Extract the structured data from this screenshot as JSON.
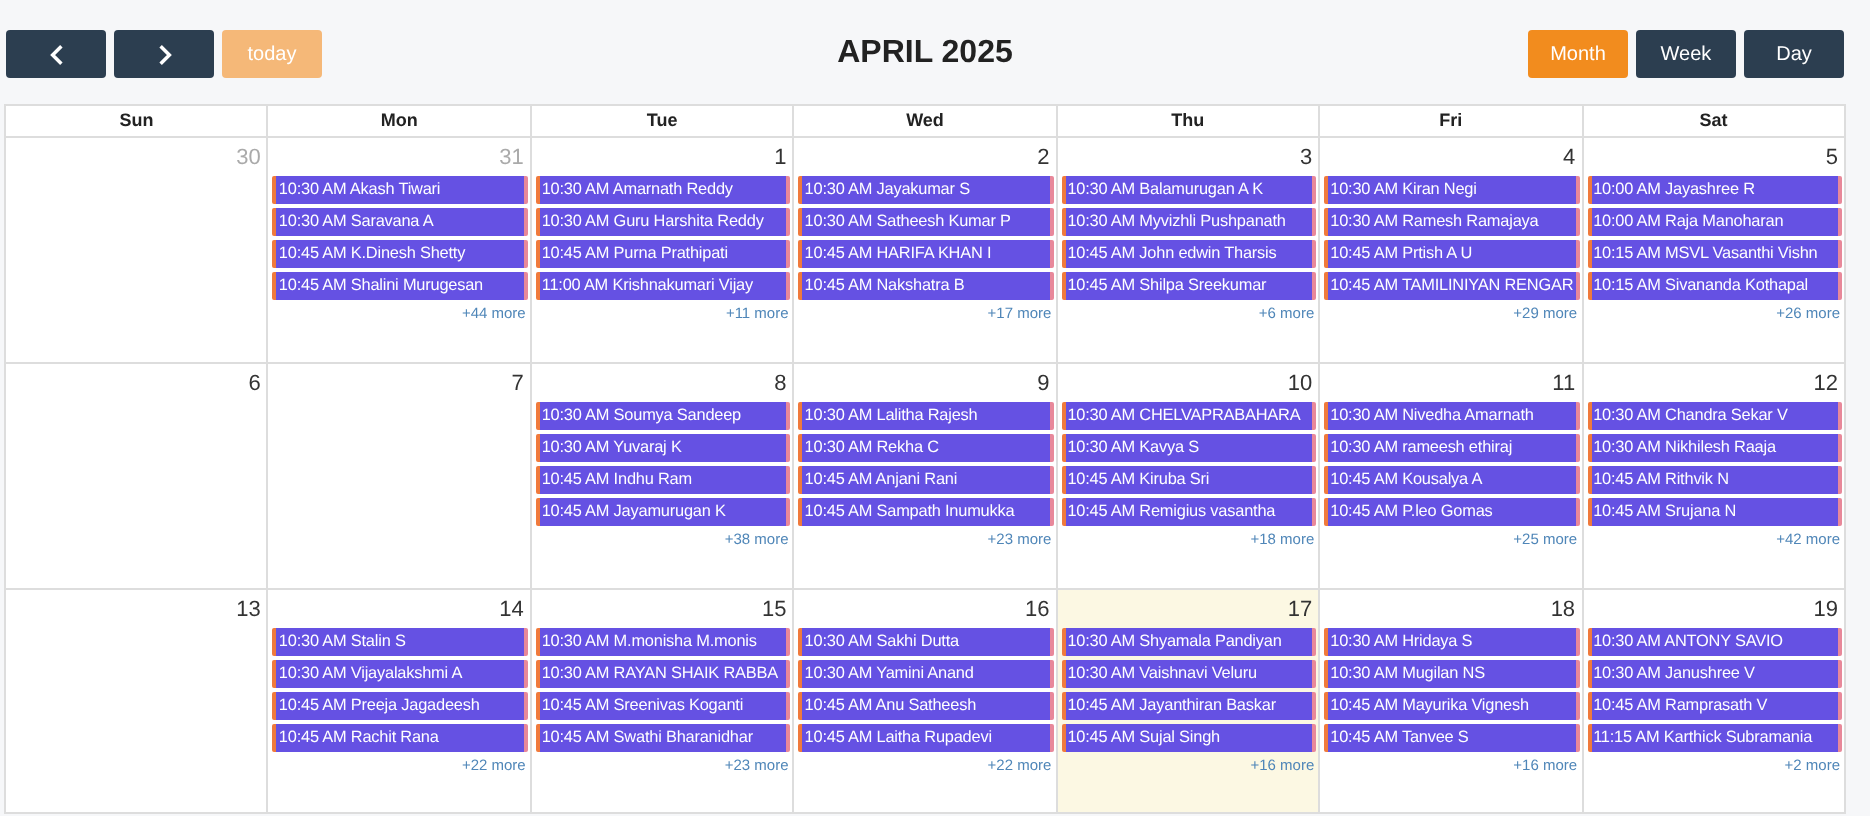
{
  "toolbar": {
    "nav_buttons": [
      {
        "kind": "prev"
      },
      {
        "kind": "next"
      }
    ],
    "today_button": {
      "label": "today",
      "disabled": true
    },
    "title": "APRIL 2025",
    "views": [
      {
        "label": "Month",
        "selected": true
      },
      {
        "label": "Week",
        "selected": false
      },
      {
        "label": "Day",
        "selected": false
      }
    ]
  },
  "calendar": {
    "weekdays": [
      "Sun",
      "Mon",
      "Tue",
      "Wed",
      "Thu",
      "Fri",
      "Sat"
    ],
    "weeks": [
      [
        {
          "day": "30",
          "other_month": true,
          "today": false
        },
        {
          "day": "31",
          "other_month": true,
          "today": false,
          "events": [
            "10:30 AM Akash Tiwari",
            "10:30 AM Saravana A",
            "10:45 AM K.Dinesh Shetty",
            "10:45 AM Shalini Murugesan"
          ],
          "more": "+44 more"
        },
        {
          "day": "1",
          "other_month": false,
          "today": false,
          "events": [
            "10:30 AM Amarnath Reddy",
            "10:30 AM Guru Harshita Reddy",
            "10:45 AM Purna Prathipati",
            "11:00 AM Krishnakumari Vijay"
          ],
          "more": "+11 more"
        },
        {
          "day": "2",
          "other_month": false,
          "today": false,
          "events": [
            "10:30 AM Jayakumar S",
            "10:30 AM Satheesh Kumar P",
            "10:45 AM HARIFA KHAN I",
            "10:45 AM Nakshatra B"
          ],
          "more": "+17 more"
        },
        {
          "day": "3",
          "other_month": false,
          "today": false,
          "events": [
            "10:30 AM Balamurugan A K",
            "10:30 AM Myvizhli Pushpanath",
            "10:45 AM John edwin Tharsis",
            "10:45 AM Shilpa Sreekumar"
          ],
          "more": "+6 more"
        },
        {
          "day": "4",
          "other_month": false,
          "today": false,
          "events": [
            "10:30 AM Kiran Negi",
            "10:30 AM Ramesh Ramajaya",
            "10:45 AM Prtish A U",
            "10:45 AM TAMILINIYAN RENGAR"
          ],
          "more": "+29 more"
        },
        {
          "day": "5",
          "other_month": false,
          "today": false,
          "events": [
            "10:00 AM Jayashree R",
            "10:00 AM Raja Manoharan",
            "10:15 AM MSVL Vasanthi Vishn",
            "10:15 AM Sivananda Kothapal"
          ],
          "more": "+26 more"
        }
      ],
      [
        {
          "day": "6",
          "other_month": false,
          "today": false
        },
        {
          "day": "7",
          "other_month": false,
          "today": false
        },
        {
          "day": "8",
          "other_month": false,
          "today": false,
          "events": [
            "10:30 AM Soumya Sandeep",
            "10:30 AM Yuvaraj K",
            "10:45 AM Indhu Ram",
            "10:45 AM Jayamurugan K"
          ],
          "more": "+38 more"
        },
        {
          "day": "9",
          "other_month": false,
          "today": false,
          "events": [
            "10:30 AM Lalitha Rajesh",
            "10:30 AM Rekha C",
            "10:45 AM Anjani Rani",
            "10:45 AM Sampath Inumukka"
          ],
          "more": "+23 more"
        },
        {
          "day": "10",
          "other_month": false,
          "today": false,
          "events": [
            "10:30 AM CHELVAPRABAHARA",
            "10:30 AM Kavya S",
            "10:45 AM Kiruba Sri",
            "10:45 AM Remigius vasantha"
          ],
          "more": "+18 more"
        },
        {
          "day": "11",
          "other_month": false,
          "today": false,
          "events": [
            "10:30 AM Nivedha Amarnath",
            "10:30 AM rameesh ethiraj",
            "10:45 AM Kousalya A",
            "10:45 AM P.leo Gomas"
          ],
          "more": "+25 more"
        },
        {
          "day": "12",
          "other_month": false,
          "today": false,
          "events": [
            "10:30 AM Chandra Sekar V",
            "10:30 AM Nikhilesh Raaja",
            "10:45 AM Rithvik N",
            "10:45 AM Srujana N"
          ],
          "more": "+42 more"
        }
      ],
      [
        {
          "day": "13",
          "other_month": false,
          "today": false
        },
        {
          "day": "14",
          "other_month": false,
          "today": false,
          "events": [
            "10:30 AM Stalin S",
            "10:30 AM Vijayalakshmi A",
            "10:45 AM Preeja Jagadeesh",
            "10:45 AM Rachit Rana"
          ],
          "more": "+22 more"
        },
        {
          "day": "15",
          "other_month": false,
          "today": false,
          "events": [
            "10:30 AM M.monisha M.monis",
            "10:30 AM RAYAN SHAIK RABBA",
            "10:45 AM Sreenivas Koganti",
            "10:45 AM Swathi Bharanidhar"
          ],
          "more": "+23 more"
        },
        {
          "day": "16",
          "other_month": false,
          "today": false,
          "events": [
            "10:30 AM Sakhi Dutta",
            "10:30 AM Yamini Anand",
            "10:45 AM Anu Satheesh",
            "10:45 AM Laitha Rupadevi"
          ],
          "more": "+22 more"
        },
        {
          "day": "17",
          "other_month": false,
          "today": true,
          "events": [
            "10:30 AM Shyamala Pandiyan",
            "10:30 AM Vaishnavi Veluru",
            "10:45 AM Jayanthiran Baskar",
            "10:45 AM Sujal Singh"
          ],
          "more": "+16 more"
        },
        {
          "day": "18",
          "other_month": false,
          "today": false,
          "events": [
            "10:30 AM Hridaya S",
            "10:30 AM Mugilan NS",
            "10:45 AM Mayurika Vignesh",
            "10:45 AM Tanvee S"
          ],
          "more": "+16 more"
        },
        {
          "day": "19",
          "other_month": false,
          "today": false,
          "events": [
            "10:30 AM ANTONY SAVIO",
            "10:30 AM Janushree V",
            "10:45 AM Ramprasath V",
            "11:15 AM Karthick Subramania"
          ],
          "more": "+2 more"
        }
      ]
    ]
  }
}
